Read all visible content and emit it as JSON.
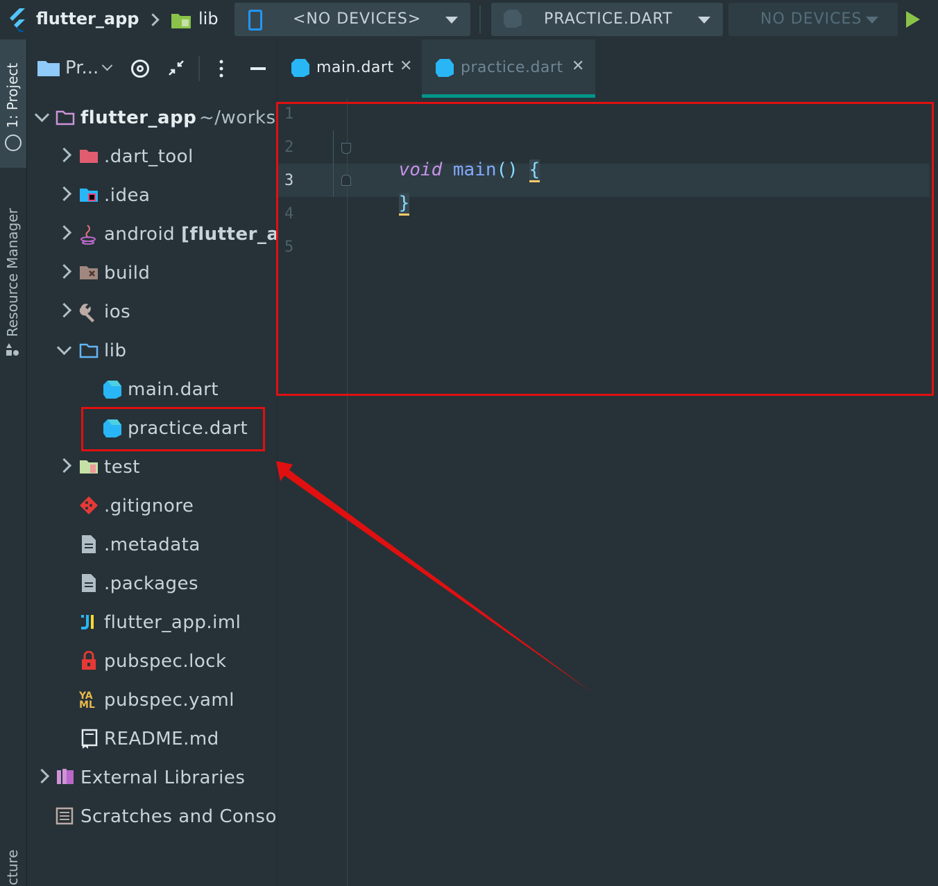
{
  "toolbar": {
    "project": "flutter_app",
    "breadcrumb_folder": "lib",
    "device_selector": "<NO DEVICES>",
    "run_config": "PRACTICE.DART",
    "secondary_devices": "NO DEVICES"
  },
  "left_strip": {
    "project_tab": "1: Project",
    "resource_manager_tab": "Resource Manager",
    "structure_tab": "cture"
  },
  "project_panel": {
    "view_selector": "Pr...",
    "root": {
      "name": "flutter_app",
      "path": "~/worksp"
    },
    "items": [
      {
        "label": ".dart_tool",
        "icon": "folder-excluded-icon"
      },
      {
        "label": ".idea",
        "icon": "idea-folder-icon"
      },
      {
        "label": "android",
        "suffix": "[flutter_ap",
        "icon": "java-icon"
      },
      {
        "label": "build",
        "icon": "build-folder-icon"
      },
      {
        "label": "ios",
        "icon": "wrench-icon"
      },
      {
        "label": "lib",
        "icon": "folder-icon"
      },
      {
        "label": "main.dart",
        "icon": "dart-icon"
      },
      {
        "label": "practice.dart",
        "icon": "dart-icon"
      },
      {
        "label": "test",
        "icon": "test-folder-icon"
      },
      {
        "label": ".gitignore",
        "icon": "git-icon"
      },
      {
        "label": ".metadata",
        "icon": "file-icon"
      },
      {
        "label": ".packages",
        "icon": "file-icon"
      },
      {
        "label": "flutter_app.iml",
        "icon": "iml-icon"
      },
      {
        "label": "pubspec.lock",
        "icon": "lock-icon"
      },
      {
        "label": "pubspec.yaml",
        "icon": "yaml-icon"
      },
      {
        "label": "README.md",
        "icon": "readme-icon"
      }
    ],
    "external_libraries": "External Libraries",
    "scratches": "Scratches and Conso"
  },
  "editor": {
    "tabs": [
      {
        "label": "main.dart",
        "active": false
      },
      {
        "label": "practice.dart",
        "active": true
      }
    ],
    "line_numbers": [
      "1",
      "2",
      "3",
      "4",
      "5"
    ],
    "code": {
      "kw_void": "void",
      "fn_main": "main",
      "parens": "()",
      "open_brace": "{",
      "close_brace": "}"
    }
  },
  "colors": {
    "background": "#263238",
    "accent": "#009688",
    "annotation": "#e01010",
    "keyword": "#c792ea",
    "function": "#82aaff"
  }
}
